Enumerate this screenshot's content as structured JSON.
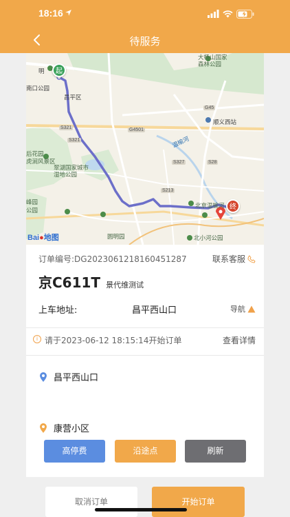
{
  "status_bar": {
    "time": "18:16"
  },
  "header": {
    "title": "待服务"
  },
  "map": {
    "labels": {
      "forest_park": "大杨山国家\n森林公园",
      "ming": "明",
      "nankou": "南口公园",
      "changping": "昌平区",
      "shunyi": "顺义西站",
      "wenyu": "温榆河",
      "huoying": "后花园",
      "hujing": "虎涧风景区",
      "cuihu": "翠湖国家城市\n湿地公园",
      "feng": "峰园",
      "park": "公园",
      "beijing": "北京温榆河",
      "yuanming": "圆明园",
      "beixiaohe": "北小河公园"
    },
    "road_signs": {
      "s321a": "S321",
      "s321b": "S321",
      "g4501": "G4501",
      "g45": "G45",
      "s327": "S327",
      "s213": "S213",
      "s28": "S28"
    },
    "start_marker": "起",
    "end_marker": "终",
    "logo_text": "Bai",
    "logo_text2": "地图"
  },
  "order": {
    "number_label": "订单编号:DG2023061218160451287",
    "contact_label": "联系客服",
    "plate": "京C611T",
    "driver": "景代维测试",
    "pickup_label": "上车地址:",
    "pickup_address": "昌平西山口",
    "nav_label": "导航"
  },
  "notice": {
    "text": "请于2023-06-12 18:15:14开始订单",
    "detail_link": "查看详情"
  },
  "stops": {
    "origin": "昌平西山口",
    "destination": "康营小区"
  },
  "buttons": {
    "high_parking": "高停费",
    "route_points": "沿途点",
    "refresh": "刷新",
    "cancel_order": "取消订单",
    "start_order": "开始订单"
  },
  "colors": {
    "header": "#f1a84a",
    "btn_high": "#5b8de0",
    "btn_route": "#f1a84a",
    "btn_refresh": "#6e6e72",
    "route_line": "#6c6fc9"
  }
}
